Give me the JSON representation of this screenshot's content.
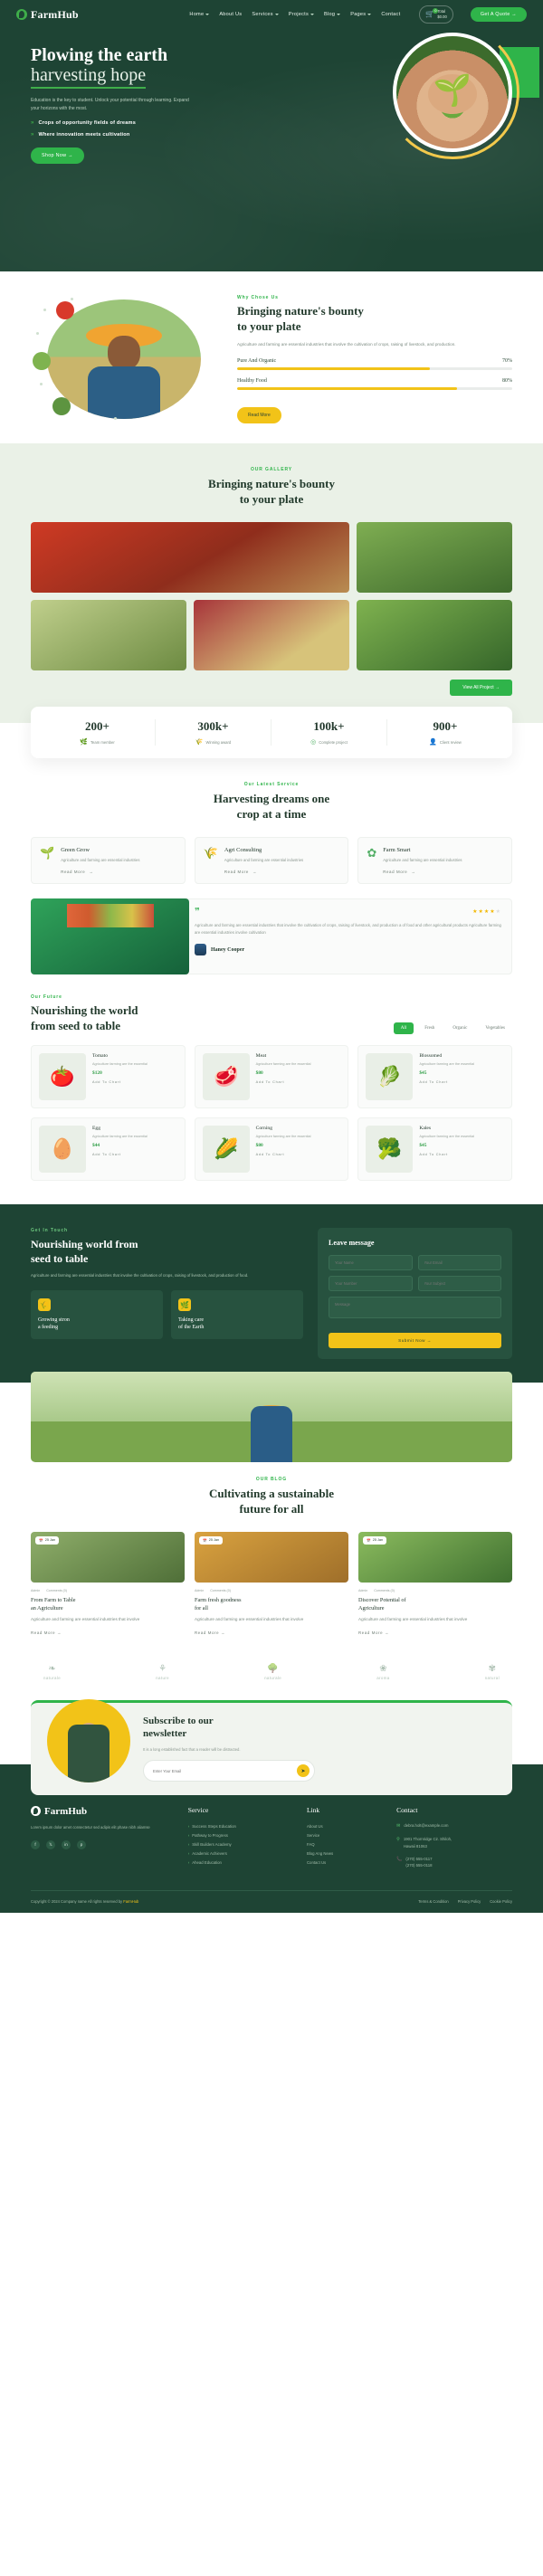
{
  "brand": {
    "name": "FarmHub",
    "logo_icon": "leaf-circle-icon"
  },
  "nav": {
    "items": [
      {
        "label": "Home",
        "caret": true
      },
      {
        "label": "About Us",
        "caret": false
      },
      {
        "label": "Services",
        "caret": true
      },
      {
        "label": "Projects",
        "caret": true
      },
      {
        "label": "Blog",
        "caret": true
      },
      {
        "label": "Pages",
        "caret": true
      },
      {
        "label": "Contact",
        "caret": false
      }
    ],
    "cart": {
      "icon": "cart-icon",
      "count": "0",
      "label_top": "Total",
      "label_bottom": "$0.00"
    },
    "cta": "Get A Quote →"
  },
  "hero": {
    "title_line1": "Plowing the earth",
    "title_line2": "harvesting hope",
    "subtitle": "Education is the key to student. Unlock your potential through learning. Expand your horizons with the most.",
    "bullets": [
      "Crops of opportunity fields of dreams",
      "Where innovation meets cultivation"
    ],
    "button": "Shop Now →"
  },
  "why": {
    "eyebrow": "Why Chose Us",
    "title_line1": "Bringing nature's bounty",
    "title_line2": "to your plate",
    "paragraph": "Agriculture and farming are essential industries that involve the cultivation of crops, raising of livestock, and production.",
    "bars": [
      {
        "label": "Pure And Organic",
        "value": "70%",
        "pct": 70
      },
      {
        "label": "Healthy Food",
        "value": "80%",
        "pct": 80
      }
    ],
    "button": "Read More"
  },
  "gallery": {
    "eyebrow": "OUR GALLERY",
    "title_line1": "Bringing nature's bounty",
    "title_line2": "to your plate",
    "button": "View All Project →",
    "items": [
      {
        "caption": "strawberry-basket-image"
      },
      {
        "caption": "farmer-greenhouse-image"
      },
      {
        "caption": "two-farmers-field-image"
      },
      {
        "caption": "lemon-harvest-image"
      },
      {
        "caption": "farmer-vegetable-crate-image"
      }
    ]
  },
  "stats": [
    {
      "number": "200+",
      "label": "Team member",
      "icon": "plant-hand-icon"
    },
    {
      "number": "300k+",
      "label": "Winning award",
      "icon": "grain-icon"
    },
    {
      "number": "100k+",
      "label": "Complete project",
      "icon": "target-icon"
    },
    {
      "number": "900+",
      "label": "Client review",
      "icon": "people-icon"
    }
  ],
  "services": {
    "eyebrow": "Our Latest Service",
    "title_line1": "Harvesting dreams one",
    "title_line2": "crop at a time",
    "cards": [
      {
        "icon": "hand-sprout-icon",
        "title": "Green Grow",
        "text": "Agriculture and farming are essential industries",
        "link": "Read More"
      },
      {
        "icon": "wheat-leaf-icon",
        "title": "Agri Consulting",
        "text": "Agriculture and farming are essential industries",
        "link": "Read More"
      },
      {
        "icon": "flower-icon",
        "title": "Farm Smart",
        "text": "Agriculture and farming are essential industries",
        "link": "Read More"
      }
    ]
  },
  "testimonial": {
    "quote_icon": "quote-icon",
    "stars_filled": 4,
    "stars_total": 5,
    "text": "Agriculture and farming are essential industries that involve the cultivation of crops, raising of livestock, and production a of food and other agricultural products Agriculture farming are essential industries involve cultivation",
    "author": "Haney Cooper",
    "image": "vegetable-bag-image"
  },
  "products": {
    "eyebrow": "Our Future",
    "title_line1": "Nourishing the world",
    "title_line2": "from seed to table",
    "filters": [
      {
        "label": "All",
        "active": true
      },
      {
        "label": "Fresh",
        "active": false
      },
      {
        "label": "Organic",
        "active": false
      },
      {
        "label": "Vegetables",
        "active": false
      }
    ],
    "items": [
      {
        "name": "Tomato",
        "desc": "Agriculture farming are the essential",
        "price": "$120",
        "cta": "Add To Chart",
        "icon": "🍅"
      },
      {
        "name": "Meat",
        "desc": "Agriculture farming are the essential",
        "price": "$80",
        "cta": "Add To Chart",
        "icon": "🥩"
      },
      {
        "name": "Blossomed",
        "desc": "Agriculture farming are the essential",
        "price": "$45",
        "cta": "Add To Chart",
        "icon": "🥬"
      },
      {
        "name": "Egg",
        "desc": "Agriculture farming are the essential",
        "price": "$44",
        "cta": "Add To Chart",
        "icon": "🥚"
      },
      {
        "name": "Corning",
        "desc": "Agriculture farming are the essential",
        "price": "$80",
        "cta": "Add To Chart",
        "icon": "🌽"
      },
      {
        "name": "Kales",
        "desc": "Agriculture farming are the essential",
        "price": "$45",
        "cta": "Add To Chart",
        "icon": "🥦"
      }
    ]
  },
  "contact_band": {
    "eyebrow": "Get In Touch",
    "title_line1": "Nourishing world from",
    "title_line2": "seed to table",
    "paragraph": "Agriculture and farming are essential industries that involve the cultivation of crops, raising of livestock, and production of food.",
    "features": [
      {
        "icon": "🌾",
        "title_line1": "Growing stron",
        "title_line2": "a feeding"
      },
      {
        "icon": "🌿",
        "title_line1": "Taking care",
        "title_line2": "of the Earth"
      }
    ],
    "form": {
      "heading": "Leave message",
      "name_placeholder": "Your Name",
      "email_placeholder": "Your Email",
      "phone_placeholder": "Your Number",
      "subject_placeholder": "Your Subject",
      "message_placeholder": "Message",
      "submit": "Submit Now →"
    }
  },
  "feature_image": {
    "caption": "farmer-celebrating-field-image"
  },
  "blog": {
    "eyebrow": "OUR BLOG",
    "title_line1": "Cultivating a sustainable",
    "title_line2": "future for all",
    "posts": [
      {
        "date": "25 Jan",
        "meta_author": "Admin",
        "meta_comments": "Comments (0)",
        "title_line1": "From Farm to Table",
        "title_line2": "an Agriculture",
        "text": "Agriculture and farming are essential industries that involve",
        "link": "Read More →",
        "image": "cows-pasture-image"
      },
      {
        "date": "25 Jan",
        "meta_author": "Admin",
        "meta_comments": "Comments (0)",
        "title_line1": "Farm fresh goodness",
        "title_line2": "for all",
        "text": "Agriculture and farming are essential industries that involve",
        "link": "Read More →",
        "image": "farmer-portrait-image"
      },
      {
        "date": "25 Jan",
        "meta_author": "Admin",
        "meta_comments": "Comments (0)",
        "title_line1": "Discover Potential of",
        "title_line2": "Agriculture",
        "text": "Agriculture and farming are essential industries that involve",
        "link": "Read More →",
        "image": "farmer-crops-image"
      }
    ]
  },
  "brands": [
    {
      "name": "naturale",
      "icon": "leaf-mark-icon"
    },
    {
      "name": "nature",
      "icon": "sprout-mark-icon"
    },
    {
      "name": "naturale",
      "icon": "tree-mark-icon"
    },
    {
      "name": "aroma",
      "icon": "swirl-mark-icon"
    },
    {
      "name": "natural",
      "icon": "seed-mark-icon"
    }
  ],
  "newsletter": {
    "title_line1": "Subscribe to our",
    "title_line2": "newsletter",
    "paragraph": "It is a long established fact that a reader will be distracted.",
    "placeholder": "Enter Your Email",
    "send_icon": "send-icon",
    "image": "farmer-with-vegetables-image"
  },
  "footer": {
    "about": "Lorem ipsum dolor amet consectetur sed adipis elit phase nibh aliamse",
    "social": [
      {
        "icon": "f",
        "name": "facebook-icon"
      },
      {
        "icon": "𝕏",
        "name": "twitter-x-icon"
      },
      {
        "icon": "in",
        "name": "linkedin-icon"
      },
      {
        "icon": "p",
        "name": "pinterest-icon"
      }
    ],
    "columns": [
      {
        "heading": "Service",
        "links": [
          "Success Steps Education",
          "Pathway to Progress",
          "Skill Builders Academy",
          "Academic Achievers",
          "Ahead Education"
        ]
      },
      {
        "heading": "Link",
        "links": [
          "About Us",
          "Service",
          "FAQ",
          "Blog Ang News",
          "Contact Us"
        ]
      }
    ],
    "contact": {
      "heading": "Contact",
      "email": "debra.holt@example.com",
      "address_line1": "1901 Thornridge Cir. Shiloh,",
      "address_line2": "Hawaii 81063",
      "phone1": "(270) 555-0117",
      "phone2": "(270) 555-0118"
    },
    "copyright_prefix": "Copyright © 2024 Company name All rights reserved by",
    "copyright_brand": "FarmHub",
    "bottom_links": [
      "Terms & Condition",
      "Privacy Policy",
      "Cookie Policy"
    ]
  }
}
